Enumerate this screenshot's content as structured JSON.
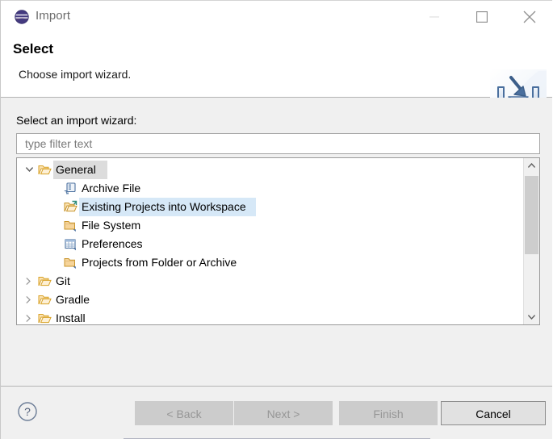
{
  "window": {
    "title": "Import",
    "app_icon": "eclipse-logo-icon",
    "controls": {
      "minimize": "minimize-icon",
      "maximize": "maximize-icon",
      "close": "close-icon"
    }
  },
  "header": {
    "title": "Select",
    "description": "Choose import wizard.",
    "banner_icon": "import-tray-arrow-icon"
  },
  "form": {
    "filter_label": "Select an import wizard:",
    "filter_value": "",
    "filter_placeholder": "type filter text"
  },
  "tree": {
    "items": [
      {
        "label": "General",
        "level": 0,
        "expanded": true,
        "twisty": "chevron-down-icon",
        "icon": "open-folder-icon",
        "state": "focused"
      },
      {
        "label": "Archive File",
        "level": 1,
        "expanded": false,
        "twisty": "",
        "icon": "archive-file-icon",
        "state": "normal"
      },
      {
        "label": "Existing Projects into Workspace",
        "level": 1,
        "expanded": false,
        "twisty": "",
        "icon": "open-folder-import-icon",
        "state": "selected"
      },
      {
        "label": "File System",
        "level": 1,
        "expanded": false,
        "twisty": "",
        "icon": "folder-icon",
        "state": "normal"
      },
      {
        "label": "Preferences",
        "level": 1,
        "expanded": false,
        "twisty": "",
        "icon": "preferences-table-icon",
        "state": "normal"
      },
      {
        "label": "Projects from Folder or Archive",
        "level": 1,
        "expanded": false,
        "twisty": "",
        "icon": "folder-icon",
        "state": "normal"
      },
      {
        "label": "Git",
        "level": 0,
        "expanded": false,
        "twisty": "chevron-right-icon",
        "icon": "open-folder-icon",
        "state": "normal"
      },
      {
        "label": "Gradle",
        "level": 0,
        "expanded": false,
        "twisty": "chevron-right-icon",
        "icon": "open-folder-icon",
        "state": "normal"
      },
      {
        "label": "Install",
        "level": 0,
        "expanded": false,
        "twisty": "chevron-right-icon",
        "icon": "open-folder-icon",
        "state": "normal"
      }
    ],
    "scrollbar": {
      "up_icon": "chevron-up-icon",
      "down_icon": "chevron-down-icon",
      "thumb_position_percent": 11,
      "thumb_size_percent": 53
    }
  },
  "footer": {
    "help_icon": "help-question-icon",
    "buttons": [
      {
        "label": "< Back",
        "enabled": false
      },
      {
        "label": "Next >",
        "enabled": false
      },
      {
        "label": "Finish",
        "enabled": false
      },
      {
        "label": "Cancel",
        "enabled": true
      }
    ]
  },
  "colors": {
    "selection_blue": "#d6e8f7",
    "focus_gray": "#dcdcdc",
    "dialog_bg": "#f0f0f0",
    "folder_gold": "#e8b96a",
    "banner_blue": "#4a6f9e"
  }
}
